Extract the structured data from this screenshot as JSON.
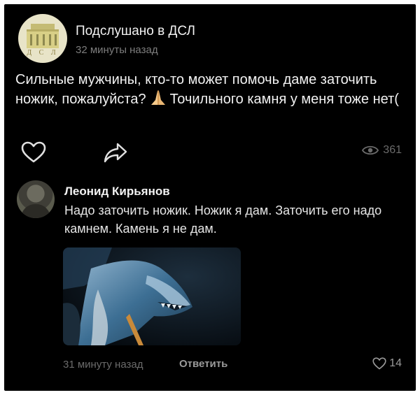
{
  "post": {
    "group_name": "Подслушано в ДСЛ",
    "time": "32 минуты назад",
    "text_before_emoji": "Сильные мужчины, кто-то может помочь даме заточить ножик, пожалуйста?",
    "text_after_emoji": "Точильного камня у меня тоже нет(",
    "views": "361",
    "avatar_letters": "Д С Л",
    "icons": {
      "like": "heart-icon",
      "share": "share-arrow-icon",
      "views": "eye-icon",
      "emoji": "praying-hands-icon"
    }
  },
  "comment": {
    "author": "Леонид Кирьянов",
    "text": "Надо заточить ножик. Ножик я дам. Заточить его надо камнем. Камень я не дам.",
    "time": "31 минуту назад",
    "reply_label": "Ответить",
    "likes": "14"
  },
  "colors": {
    "background": "#000000",
    "text": "#f2f2f2",
    "muted": "#6b6b6b"
  }
}
